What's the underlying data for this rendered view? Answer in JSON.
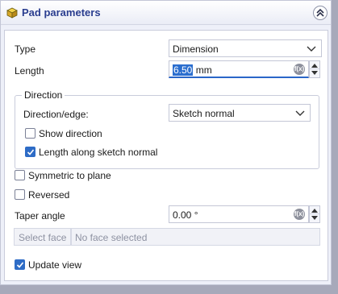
{
  "panel": {
    "title": "Pad parameters",
    "icons": {
      "header": "pad-icon",
      "collapse": "double-chevron-up-icon"
    }
  },
  "fields": {
    "type_label": "Type",
    "type_value": "Dimension",
    "length_label": "Length",
    "length_value": "6.50",
    "length_unit": "mm",
    "direction_group": "Direction",
    "direction_edge_label": "Direction/edge:",
    "direction_edge_value": "Sketch normal",
    "show_direction_label": "Show direction",
    "show_direction_checked": false,
    "length_along_label": "Length along sketch normal",
    "length_along_checked": true,
    "symmetric_label": "Symmetric to plane",
    "symmetric_checked": false,
    "reversed_label": "Reversed",
    "reversed_checked": false,
    "taper_label": "Taper angle",
    "taper_value": "0.00 °",
    "select_face_label": "Select face",
    "face_value": "No face selected",
    "update_view_label": "Update view",
    "update_view_checked": true
  },
  "colors": {
    "accent": "#2e6cc6",
    "title": "#2a3d8f",
    "background": "#eef0f9"
  }
}
